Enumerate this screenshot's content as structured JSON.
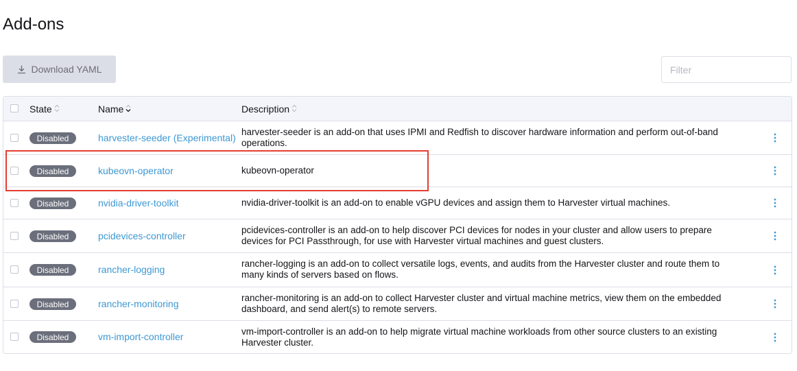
{
  "page": {
    "title": "Add-ons"
  },
  "toolbar": {
    "download_label": "Download YAML",
    "download_icon": "download-icon"
  },
  "filter": {
    "placeholder": "Filter",
    "value": ""
  },
  "table": {
    "headers": {
      "state": "State",
      "name": "Name",
      "description": "Description"
    },
    "rows": [
      {
        "state": "Disabled",
        "name": "harvester-seeder (Experimental)",
        "description": "harvester-seeder is an add-on that uses IPMI and Redfish to discover hardware information and perform out-of-band operations."
      },
      {
        "state": "Disabled",
        "name": "kubeovn-operator",
        "description": "kubeovn-operator"
      },
      {
        "state": "Disabled",
        "name": "nvidia-driver-toolkit",
        "description": "nvidia-driver-toolkit is an add-on to enable vGPU devices and assign them to Harvester virtual machines."
      },
      {
        "state": "Disabled",
        "name": "pcidevices-controller",
        "description": "pcidevices-controller is an add-on to help discover PCI devices for nodes in your cluster and allow users to prepare devices for PCI Passthrough, for use with Harvester virtual machines and guest clusters."
      },
      {
        "state": "Disabled",
        "name": "rancher-logging",
        "description": "rancher-logging is an add-on to collect versatile logs, events, and audits from the Harvester cluster and route them to many kinds of servers based on flows."
      },
      {
        "state": "Disabled",
        "name": "rancher-monitoring",
        "description": "rancher-monitoring is an add-on to collect Harvester cluster and virtual machine metrics, view them on the embedded dashboard, and send alert(s) to remote servers."
      },
      {
        "state": "Disabled",
        "name": "vm-import-controller",
        "description": "vm-import-controller is an add-on to help migrate virtual machine workloads from other source clusters to an existing Harvester cluster."
      }
    ]
  },
  "colors": {
    "link": "#3d98d3",
    "badge_bg": "#6b6e7b",
    "highlight": "#e53d30",
    "button_bg": "#dcdee7"
  }
}
